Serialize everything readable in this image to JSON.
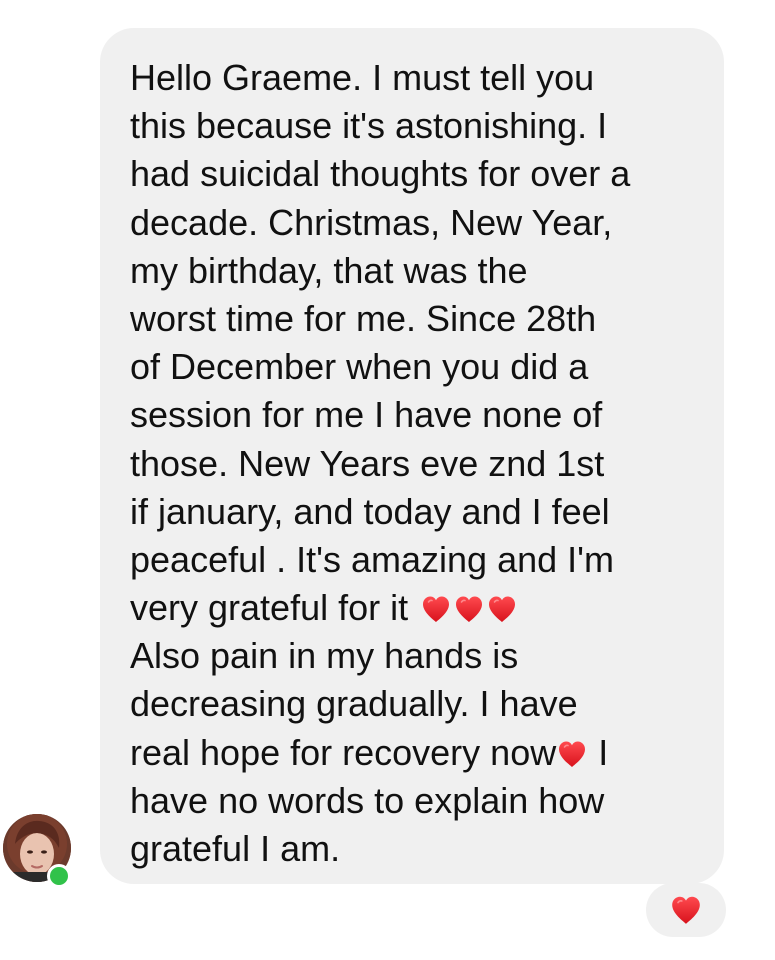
{
  "message": {
    "lines": [
      "Hello Graeme. I must tell you",
      "this because it's astonishing. I",
      "had suicidal thoughts for over a",
      "decade. Christmas,  New Year,",
      "my birthday,  that was the",
      "worst time for me. Since 28th",
      "of December when you did a",
      "session for me I have none of",
      "those.  New Years eve znd 1st",
      "if january, and today and I feel",
      "peaceful . It's amazing and I'm",
      "very grateful for it ",
      "Also pain in my hands is",
      "decreasing gradually.  I have",
      "real hope for recovery now",
      " I",
      "have no words to explain how",
      "grateful I am."
    ]
  },
  "colors": {
    "bubble_bg": "#f0f0f0",
    "heart": "#e8202a",
    "online_status": "#31c24a"
  },
  "icons": {
    "heart": "heart-icon",
    "avatar": "avatar",
    "status": "online-status-dot"
  }
}
